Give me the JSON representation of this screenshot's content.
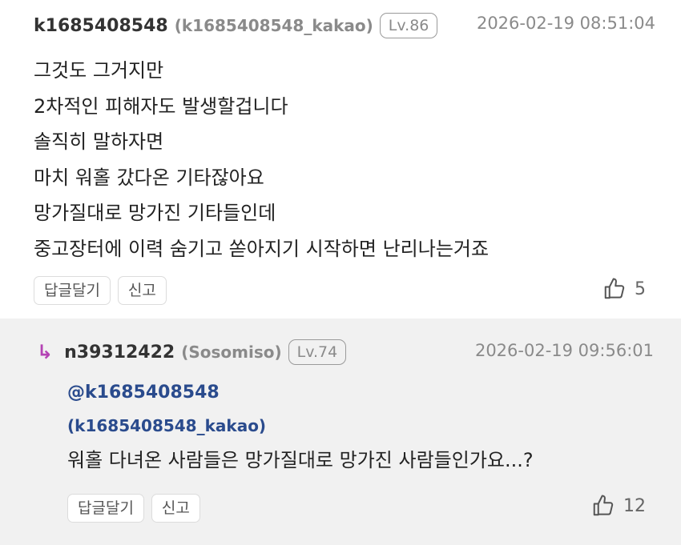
{
  "comment1": {
    "user_id": "k1685408548",
    "nickname": "(k1685408548_kakao)",
    "level": "Lv.86",
    "timestamp": "2026-02-19 08:51:04",
    "lines": [
      "그것도 그거지만",
      "2차적인 피해자도 발생할겁니다",
      "솔직히 말하자면",
      "마치 워홀 갔다온 기타잖아요",
      "망가질대로 망가진 기타들인데",
      "중고장터에 이력 숨기고 쏟아지기 시작하면 난리나는거죠"
    ],
    "reply_button": "답글달기",
    "report_button": "신고",
    "like_count": "5"
  },
  "comment2": {
    "reply_indicator": "↳",
    "user_id": "n39312422",
    "nickname": "(Sosomiso)",
    "level": "Lv.74",
    "timestamp": "2026-02-19 09:56:01",
    "mention_line1": "@k1685408548",
    "mention_line2": "(k1685408548_kakao)",
    "text": "워홀 다녀온 사람들은 망가질대로 망가진 사람들인가요...?",
    "reply_button": "답글달기",
    "report_button": "신고",
    "like_count": "12"
  }
}
